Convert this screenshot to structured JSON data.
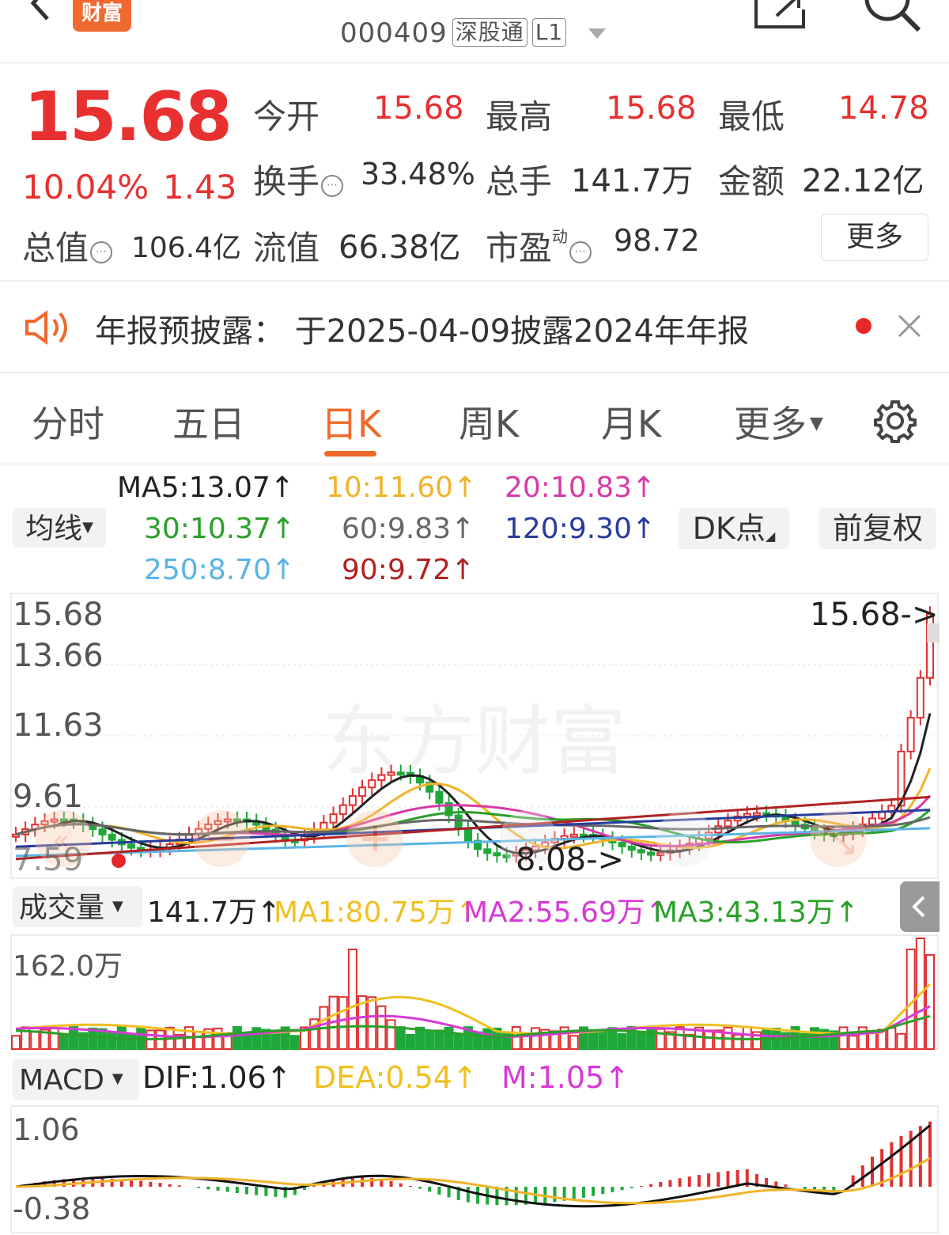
{
  "header": {
    "logo_text": "财富",
    "stock_code": "000409",
    "badge_connect": "深股通",
    "badge_level": "L1"
  },
  "quote": {
    "price": "15.68",
    "change_pct": "10.04%",
    "change_amt": "1.43",
    "open_label": "今开",
    "open": "15.68",
    "high_label": "最高",
    "high": "15.68",
    "low_label": "最低",
    "low": "14.78",
    "turnover_label": "换手",
    "turnover": "33.48%",
    "volume_label": "总手",
    "volume": "141.7万",
    "amount_label": "金额",
    "amount": "22.12亿",
    "mktcap_label": "总值",
    "mktcap": "106.4亿",
    "float_label": "流值",
    "float": "66.38亿",
    "pe_label": "市盈",
    "pe_sup": "动",
    "pe": "98.72",
    "more_button": "更多"
  },
  "notice": {
    "text": "年报预披露：  于2025-04-09披露2024年年报"
  },
  "tabs": [
    {
      "label": "分时"
    },
    {
      "label": "五日"
    },
    {
      "label": "日K",
      "active": true
    },
    {
      "label": "周K"
    },
    {
      "label": "月K"
    },
    {
      "label": "更多"
    }
  ],
  "ma_legend": {
    "selector": "均线",
    "ma5": "MA5:13.07↑",
    "ma10": "10:11.60↑",
    "ma20": "20:10.83↑",
    "ma30": "30:10.37↑",
    "ma60": "60:9.83↑",
    "ma120": "120:9.30↑",
    "ma250": "250:8.70↑",
    "ma90": "90:9.72↑",
    "dk_button": "DK点",
    "fq_button": "前复权",
    "colors": {
      "ma5": "#222222",
      "ma10": "#f0b429",
      "ma20": "#d63aa8",
      "ma30": "#2aa02a",
      "ma60": "#666666",
      "ma120": "#283c9c",
      "ma250": "#5ab4e6",
      "ma90": "#b22222"
    }
  },
  "kline": {
    "y_labels": [
      "15.68",
      "13.66",
      "11.63",
      "9.61",
      "7.59"
    ],
    "last_marker": "15.68->",
    "low_marker": "8.08->",
    "watermark": "东方财富"
  },
  "volume": {
    "selector": "成交量",
    "current": "141.7万↑",
    "ma1": "MA1:80.75万↑",
    "ma2": "MA2:55.69万↑",
    "ma3": "MA3:43.13万↑",
    "y_top": "162.0万"
  },
  "macd": {
    "selector": "MACD",
    "dif": "DIF:1.06↑",
    "dea": "DEA:0.54↑",
    "m": "M:1.05↑",
    "y_top": "1.06",
    "y_bottom": "-0.38"
  },
  "chart_data": {
    "type": "candlestick",
    "y_range": [
      7.59,
      15.68
    ],
    "last_close": 15.68,
    "period_low": 8.08,
    "ma_values": {
      "MA5": 13.07,
      "MA10": 11.6,
      "MA20": 10.83,
      "MA30": 10.37,
      "MA60": 9.83,
      "MA120": 9.3,
      "MA250": 8.7,
      "MA90": 9.72
    },
    "volume_y_top": "162.0万",
    "macd_range": [
      -0.38,
      1.06
    ]
  }
}
